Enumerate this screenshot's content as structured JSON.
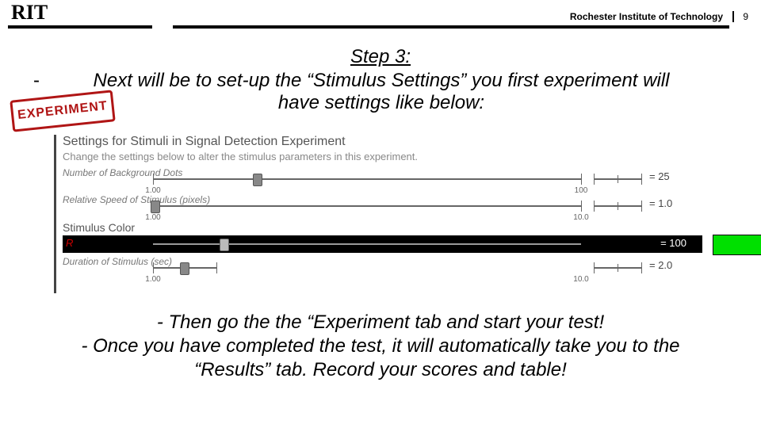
{
  "header": {
    "logo_text": "RIT",
    "full_name": "Rochester Institute of Technology",
    "page_number": "9"
  },
  "step": {
    "title": "Step 3:",
    "line1": "Next will be to set-up the “Stimulus Settings” you first experiment will",
    "line2": "have settings like below:"
  },
  "stamp": {
    "text": "EXPERIMENT"
  },
  "panel": {
    "title": "Settings for Stimuli in Signal Detection Experiment",
    "desc": "Change the settings below to alter the stimulus parameters in this experiment.",
    "settings": {
      "bg_dots": {
        "label": "Number of Background Dots",
        "min": "1.00",
        "max": "100",
        "value": "= 25"
      },
      "rel_speed": {
        "label": "Relative Speed of Stimulus (pixels)",
        "min": "1.00",
        "max": "10.0",
        "value": "= 1.0"
      },
      "stim_color_label": "Stimulus Color",
      "r": {
        "label": "R",
        "value": "= 100"
      },
      "duration": {
        "label": "Duration of Stimulus (sec)",
        "min": "1.00",
        "max": "10.0",
        "value": "= 2.0"
      }
    },
    "swatch_color": "#00e000"
  },
  "lower": {
    "b1": "-   Then go the the “Experiment tab and start your test!",
    "b2_l1": "-   Once you have completed the test, it will automatically take you to the",
    "b2_l2": "“Results” tab. Record your scores and table!"
  }
}
